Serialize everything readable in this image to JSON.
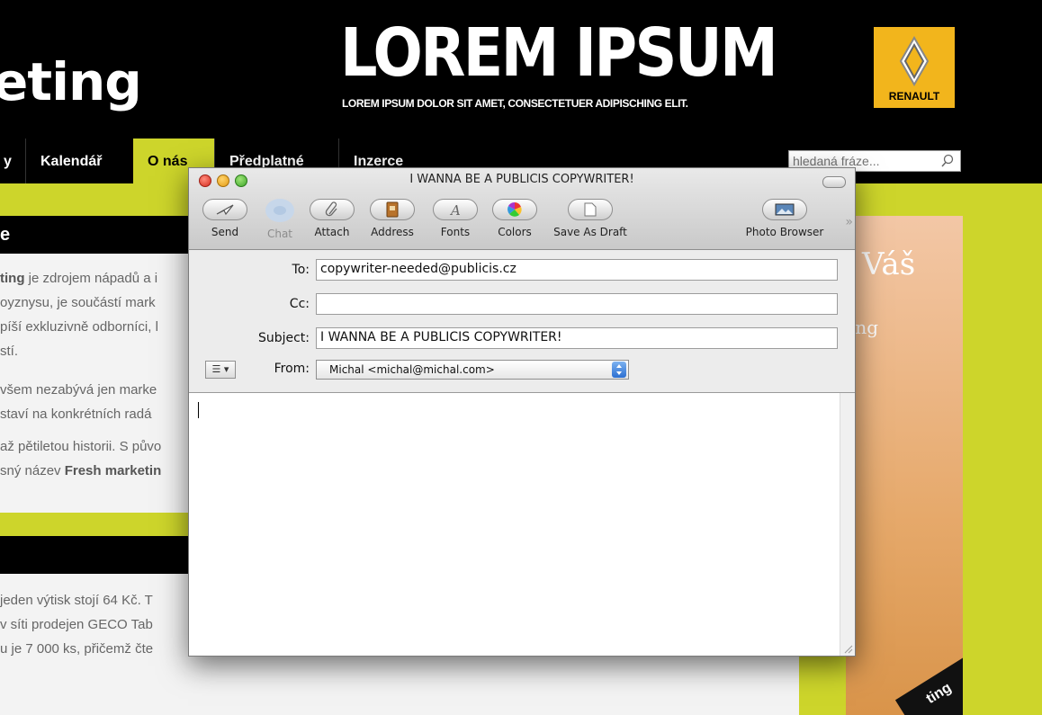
{
  "site": {
    "logo_fragment": "eting",
    "hero_title": "LOREM IPSUM",
    "hero_subtitle": "LOREM IPSUM DOLOR SIT AMET, CONSECTETUER ADIPISCHING ELIT.",
    "brand": "RENAULT",
    "nav": [
      {
        "label": "y"
      },
      {
        "label": "Kalendář"
      },
      {
        "label": "O nás"
      },
      {
        "label": "Předplatné"
      },
      {
        "label": "Inzerce"
      }
    ],
    "search_placeholder": "hledaná fráze...",
    "section1_heading": "e",
    "section2_heading": "",
    "para1": {
      "bold": "ting",
      "l1": " je zdrojem nápadů a i",
      "l2": "oyznysu, je součástí mark",
      "l3": "píší exkluzivně odborníci, l",
      "l4": "stí."
    },
    "para2": {
      "l1": "všem nezabývá jen marke",
      "l2": " staví na konkrétních radá"
    },
    "para3": {
      "l1": "až pětiletou historii. S půvo",
      "l2_pre": "sný název ",
      "l2_bold": "Fresh marketin"
    },
    "para4": {
      "l1": "jeden výtisk stojí 64 Kč. T",
      "l2": "v síti prodejen GECO Tab",
      "l3": "u je 7 000 ks, přičemž čte"
    },
    "promo_title": "Váš",
    "promo_sub": "ing",
    "promo_book": "ting"
  },
  "mail": {
    "window_title": "I WANNA BE A PUBLICIS COPYWRITER!",
    "toolbar": [
      {
        "label": "Send",
        "icon": "send-icon"
      },
      {
        "label": "Chat",
        "icon": "chat-icon"
      },
      {
        "label": "Attach",
        "icon": "paperclip-icon"
      },
      {
        "label": "Address",
        "icon": "address-book-icon"
      },
      {
        "label": "Fonts",
        "icon": "font-icon"
      },
      {
        "label": "Colors",
        "icon": "color-wheel-icon"
      },
      {
        "label": "Save As Draft",
        "icon": "draft-icon"
      },
      {
        "label": "Photo Browser",
        "icon": "photo-icon"
      }
    ],
    "to_label": "To:",
    "to_value": "copywriter-needed@publicis.cz",
    "cc_label": "Cc:",
    "cc_value": "",
    "subject_label": "Subject:",
    "subject_value": "I WANNA BE A PUBLICIS COPYWRITER!",
    "from_label": "From:",
    "from_value": "Michal <michal@michal.com>",
    "sig_menu": "☰ ▾",
    "body": ""
  },
  "colors": {
    "accent": "#cdd52b",
    "brand_yellow": "#f2b51c"
  }
}
